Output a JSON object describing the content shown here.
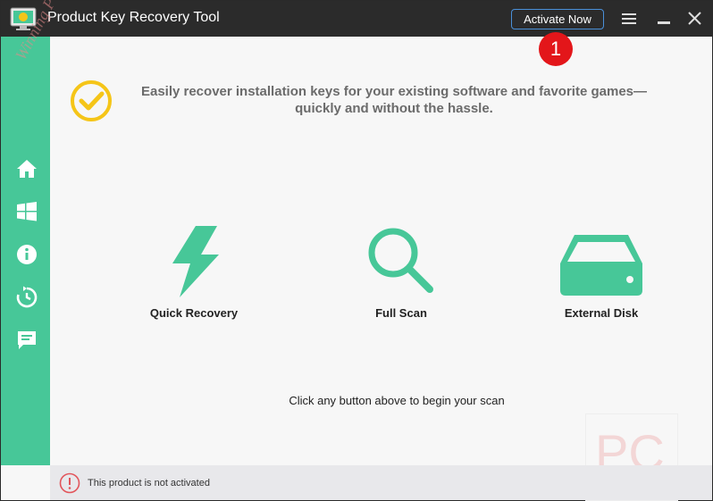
{
  "window": {
    "title": "Product Key Recovery Tool",
    "activate_label": "Activate Now",
    "badge_number": "1"
  },
  "colors": {
    "accent_green": "#47c798",
    "titlebar": "#2b2b2b",
    "check_yellow": "#f5c518",
    "badge_red": "#e3161a",
    "status_red": "#e2555b"
  },
  "sidebar": {
    "items": [
      {
        "icon": "home-icon"
      },
      {
        "icon": "windows-icon"
      },
      {
        "icon": "info-icon"
      },
      {
        "icon": "history-icon"
      },
      {
        "icon": "feedback-icon"
      }
    ]
  },
  "main": {
    "headline": "Easily recover installation keys for your existing software and favorite games—quickly and without the hassle.",
    "actions": [
      {
        "label": "Quick Recovery",
        "icon": "lightning-icon"
      },
      {
        "label": "Full Scan",
        "icon": "magnifier-icon"
      },
      {
        "label": "External Disk",
        "icon": "external-disk-icon"
      }
    ],
    "hint": "Click any button above to begin your scan"
  },
  "watermark": {
    "text": "Winning PC",
    "logo": "PC"
  },
  "status": {
    "text": "This product is not activated"
  }
}
